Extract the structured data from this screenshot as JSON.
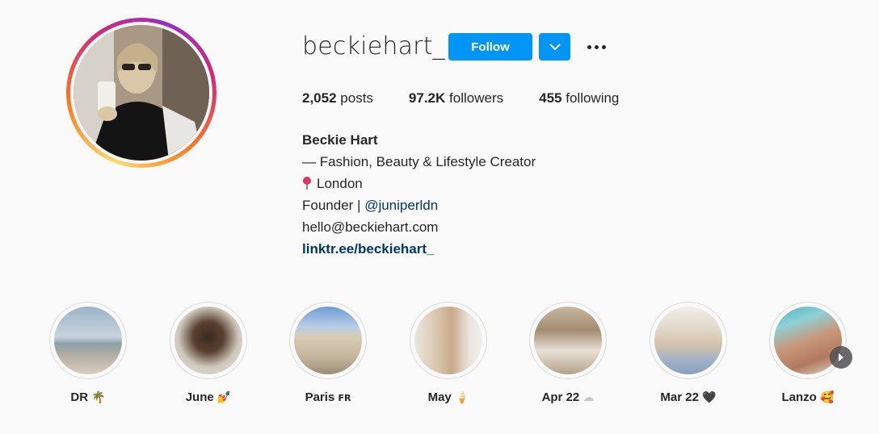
{
  "profile": {
    "username": "beckiehart_",
    "follow_label": "Follow",
    "stats": [
      {
        "value": "2,052",
        "label": "posts"
      },
      {
        "value": "97.2K",
        "label": "followers"
      },
      {
        "value": "455",
        "label": "following"
      }
    ],
    "bio": {
      "name": "Beckie Hart",
      "line1": "— Fashion, Beauty & Lifestyle Creator",
      "location": "London",
      "founder_prefix": "Founder | ",
      "founder_mention": "@juniperldn",
      "email": "hello@beckiehart.com",
      "website": "linktr.ee/beckiehart_"
    }
  },
  "highlights": [
    {
      "label": "DR",
      "emoji": "🌴"
    },
    {
      "label": "June",
      "emoji": "💅"
    },
    {
      "label": "Paris",
      "emoji": "FR"
    },
    {
      "label": "May",
      "emoji": "🍦"
    },
    {
      "label": "Apr 22",
      "emoji": "☁"
    },
    {
      "label": "Mar 22",
      "emoji": "🖤"
    },
    {
      "label": "Lanzo",
      "emoji": "🥰"
    }
  ],
  "icons": {
    "dropdown": "chevron-down-icon",
    "more": "more-options-icon",
    "next": "chevron-right-icon",
    "location": "pin-icon"
  },
  "colors": {
    "accent": "#0095f6",
    "link": "#00376b",
    "text": "#262626",
    "background": "#fafafa"
  }
}
